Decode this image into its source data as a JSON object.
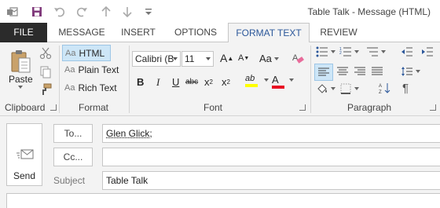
{
  "window": {
    "title": "Table Talk - Message (HTML)"
  },
  "qat": {
    "icons": [
      "outlook-icon",
      "save-icon",
      "undo-icon",
      "redo-icon",
      "up-arrow-icon",
      "down-arrow-icon",
      "customize-qat-icon"
    ]
  },
  "tabs": [
    {
      "label": "FILE"
    },
    {
      "label": "MESSAGE"
    },
    {
      "label": "INSERT"
    },
    {
      "label": "OPTIONS"
    },
    {
      "label": "FORMAT TEXT"
    },
    {
      "label": "REVIEW"
    }
  ],
  "active_tab": "FORMAT TEXT",
  "ribbon": {
    "clipboard": {
      "label": "Clipboard",
      "paste_label": "Paste"
    },
    "format": {
      "label": "Format",
      "html_label": "HTML",
      "plain_label": "Plain Text",
      "rich_label": "Rich Text",
      "aa_glyph": "Aa",
      "selected": "HTML"
    },
    "font": {
      "label": "Font",
      "font_name": "Calibri (B",
      "font_size": "11",
      "grow_glyph": "A",
      "shrink_glyph": "A",
      "case_glyph": "Aa",
      "bold": "B",
      "italic": "I",
      "underline": "U",
      "strike": "abc",
      "subscript": "x",
      "superscript": "x",
      "sub_mark": "2",
      "sup_mark": "2",
      "highlight_glyph": "ab",
      "color_glyph": "A",
      "highlight_color": "#ffff00",
      "font_color": "#e81123"
    },
    "paragraph": {
      "label": "Paragraph",
      "pilcrow": "¶"
    }
  },
  "compose": {
    "send_label": "Send",
    "to_label": "To...",
    "cc_label": "Cc...",
    "subject_label": "Subject",
    "to_value": "Glen Glick;",
    "cc_value": "",
    "subject_value": "Table Talk"
  },
  "colors": {
    "accent": "#2b579a",
    "file_tab_bg": "#2b2b2b",
    "save_icon": "#80397b",
    "ribbon_bg": "#f3f3f3"
  }
}
